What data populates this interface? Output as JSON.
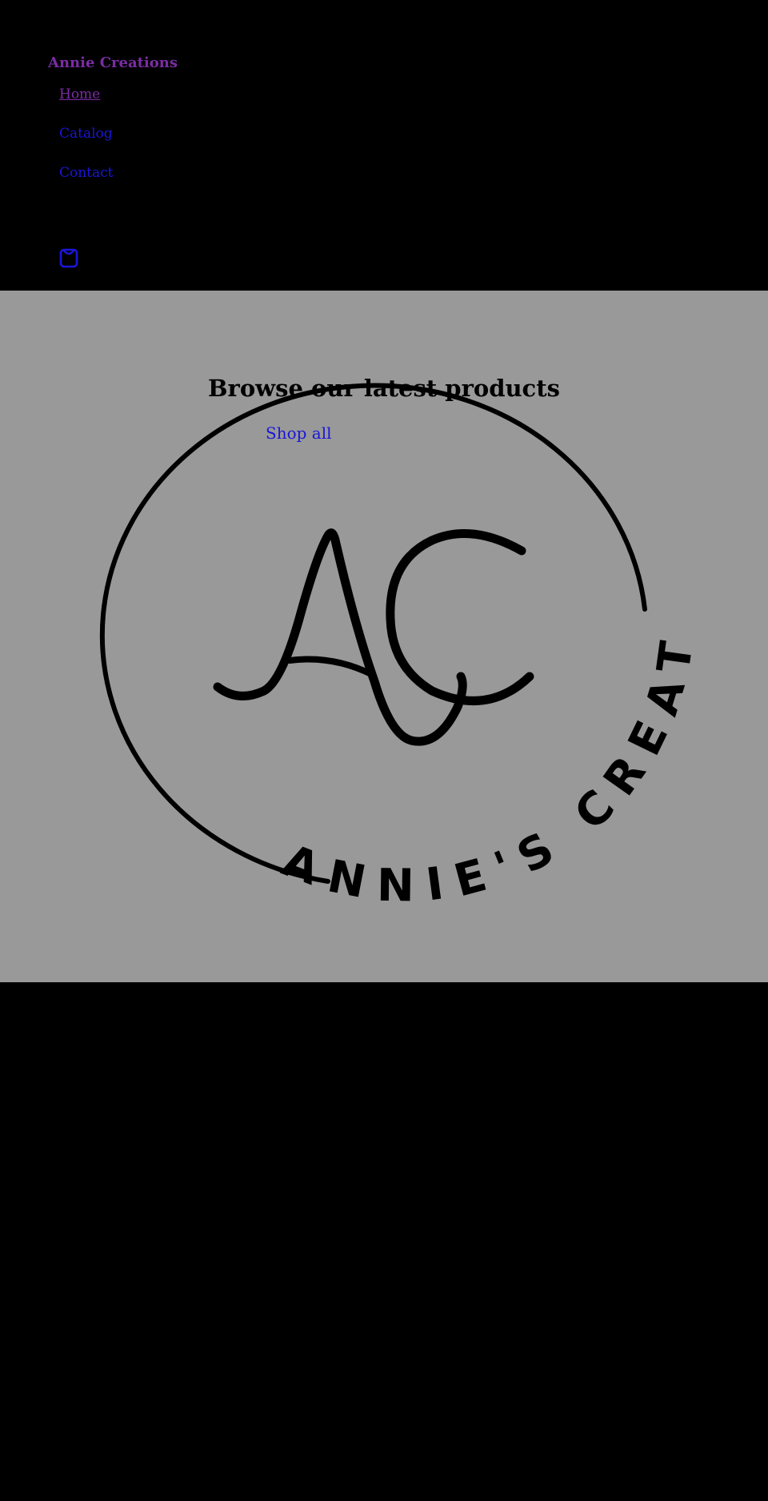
{
  "header": {
    "site_title": "Annie Creations",
    "nav": [
      {
        "label": "Home",
        "visited": true
      },
      {
        "label": "Catalog",
        "visited": false
      },
      {
        "label": "Contact",
        "visited": false
      }
    ],
    "cart_icon": "shopping-bag-icon"
  },
  "hero": {
    "heading": "Browse our latest products",
    "cta_label": "Shop all",
    "logo": {
      "monogram": "AC",
      "ring_text": "ANNIE'S CREATION"
    }
  },
  "colors": {
    "page_background": "#000000",
    "hero_background": "#999999",
    "link": "#1a16d8",
    "visited_link": "#7b2ca5",
    "logo_ink": "#000000"
  }
}
